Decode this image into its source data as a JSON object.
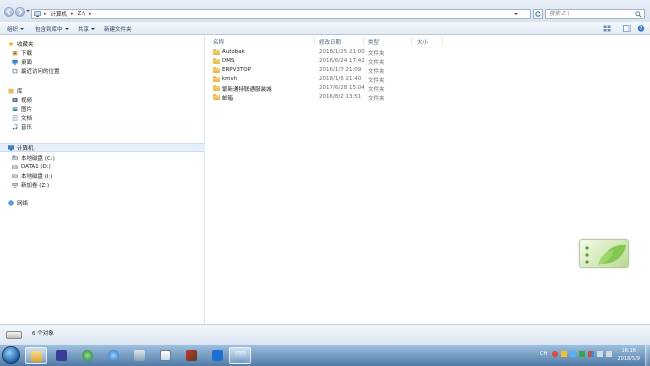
{
  "address_bar": {
    "segments": [
      "计算机",
      "Z:\\"
    ],
    "search_placeholder": "搜索 Z:\\"
  },
  "toolbar": {
    "organize": "组织",
    "include_in_library": "包含到库中",
    "share": "共享",
    "new_folder": "新建文件夹"
  },
  "nav": {
    "favorites": "收藏夹",
    "downloads": "下载",
    "desktop": "桌面",
    "recent_places": "最近访问的位置",
    "libraries": "库",
    "videos": "视频",
    "pictures": "图片",
    "documents": "文档",
    "music": "音乐",
    "computer": "计算机",
    "local_disk_c": "本地磁盘 (C:)",
    "data1_d": "DATA1 (D:)",
    "local_disk_i": "本地磁盘 (I:)",
    "new_volume_z": "新加卷 (Z:)",
    "network": "网络"
  },
  "columns": {
    "name": "名称",
    "date_modified": "修改日期",
    "type": "类型",
    "size": "大小"
  },
  "files": [
    {
      "name": "Autobak",
      "date": "2018/1/25 21:00",
      "type": "文件夹"
    },
    {
      "name": "DMS",
      "date": "2016/6/24 17:42",
      "type": "文件夹"
    },
    {
      "name": "ERPV3TOP",
      "date": "2016/1/7 21:09",
      "type": "文件夹"
    },
    {
      "name": "kmvh",
      "date": "2018/1/6 21:40",
      "type": "文件夹"
    },
    {
      "name": "繁新通特联通服装城",
      "date": "2017/6/28 15:04",
      "type": "文件夹"
    },
    {
      "name": "邮箱",
      "date": "2016/8/2 13:51",
      "type": "文件夹"
    }
  ],
  "status": {
    "count": "6 个对象"
  },
  "taskbar": {
    "time": "16:16",
    "date": "2018/5/9",
    "lang": "CH"
  },
  "colors": {
    "accent": "#2b5797",
    "selection": "#e5eefb",
    "folder": "#e8b84c"
  }
}
